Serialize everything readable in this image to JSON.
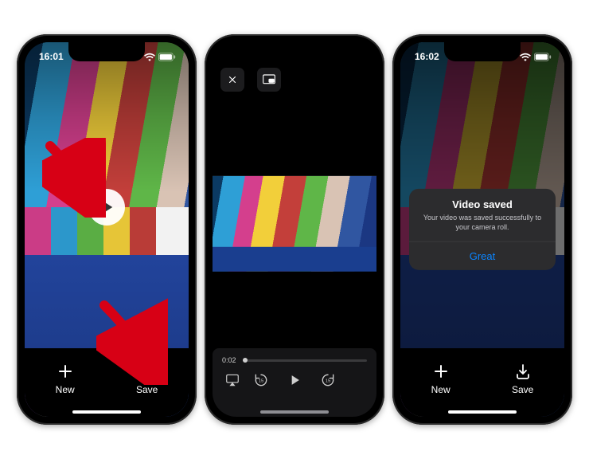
{
  "status": {
    "time": "16:01",
    "time_mid": "",
    "time_right": "16:02"
  },
  "buttons": {
    "new_label": "New",
    "save_label": "Save"
  },
  "player": {
    "time_elapsed": "0:02"
  },
  "alert": {
    "title": "Video saved",
    "message": "Your video was saved successfully to your camera roll.",
    "confirm": "Great"
  }
}
